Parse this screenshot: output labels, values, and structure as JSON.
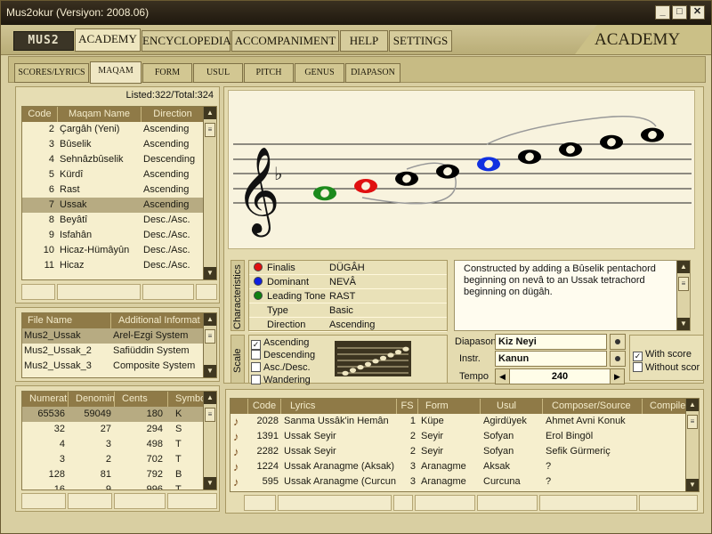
{
  "window": {
    "title": "Mus2okur  (Versiyon: 2008.06)",
    "minimize": "_",
    "maximize": "□",
    "close": "✕"
  },
  "logo": "MUS2",
  "main_tabs": [
    "ACADEMY",
    "ENCYCLOPEDIA",
    "ACCOMPANIMENT",
    "HELP",
    "SETTINGS"
  ],
  "section_title": "ACADEMY",
  "sub_tabs": [
    "SCORES/LYRICS",
    "MAQAM",
    "FORM",
    "USUL",
    "PITCH",
    "GENUS",
    "DIAPASON"
  ],
  "maqam_list": {
    "listed": "Listed:322/Total:324",
    "columns": [
      "Code",
      "Maqam Name",
      "Direction"
    ],
    "rows": [
      [
        "2",
        "Çargâh (Yeni)",
        "Ascending"
      ],
      [
        "3",
        "Bûselik",
        "Ascending"
      ],
      [
        "4",
        "Sehnâzbûselik",
        "Descending"
      ],
      [
        "5",
        "Kürdî",
        "Ascending"
      ],
      [
        "6",
        "Rast",
        "Ascending"
      ],
      [
        "7",
        "Ussak",
        "Ascending"
      ],
      [
        "8",
        "Beyâtî",
        "Desc./Asc."
      ],
      [
        "9",
        "Isfahân",
        "Desc./Asc."
      ],
      [
        "10",
        "Hicaz-Hümâyûn",
        "Desc./Asc."
      ],
      [
        "11",
        "Hicaz",
        "Desc./Asc."
      ]
    ],
    "selected_index": 5
  },
  "files": {
    "columns": [
      "File Name",
      "Additional Informat"
    ],
    "rows": [
      [
        "Mus2_Ussak",
        "Arel-Ezgi System"
      ],
      [
        "Mus2_Ussak_2",
        "Safiüddin System"
      ],
      [
        "Mus2_Ussak_3",
        "Composite System"
      ]
    ],
    "selected_index": 0
  },
  "ratios": {
    "columns": [
      "Numerat",
      "Denomin",
      "Cents",
      "Symbo"
    ],
    "rows": [
      [
        "65536",
        "59049",
        "180",
        "K"
      ],
      [
        "32",
        "27",
        "294",
        "S"
      ],
      [
        "4",
        "3",
        "498",
        "T"
      ],
      [
        "3",
        "2",
        "702",
        "T"
      ],
      [
        "128",
        "81",
        "792",
        "B"
      ],
      [
        "16",
        "9",
        "996",
        "T"
      ]
    ],
    "selected_index": 0
  },
  "characteristics": {
    "label": "Characteristics",
    "rows": [
      {
        "name": "Finalis",
        "value": "DÜGÂH",
        "color": "#e01010"
      },
      {
        "name": "Dominant",
        "value": "NEVÂ",
        "color": "#1020e0"
      },
      {
        "name": "Leading Tone",
        "value": "RAST",
        "color": "#108010"
      },
      {
        "name": "Type",
        "value": "Basic",
        "color": ""
      },
      {
        "name": "Direction",
        "value": "Ascending",
        "color": ""
      }
    ],
    "description": "Constructed by adding a Bûselik pentachord beginning on nevâ to an Ussak tetrachord beginning on dügâh."
  },
  "scale": {
    "label": "Scale",
    "options": [
      {
        "label": "Ascending",
        "checked": true
      },
      {
        "label": "Descending",
        "checked": false
      },
      {
        "label": "Asc./Desc.",
        "checked": false
      },
      {
        "label": "Wandering",
        "checked": false
      }
    ]
  },
  "playback": {
    "diapason_label": "Diapason",
    "diapason_value": "Kiz Neyi",
    "instr_label": "Instr.",
    "instr_value": "Kanun",
    "tempo_label": "Tempo",
    "tempo_value": "240",
    "with_score": "With score",
    "with_score_checked": true,
    "without_score": "Without scor",
    "without_score_checked": false
  },
  "works": {
    "columns": [
      "Code",
      "Lyrics",
      "FS",
      "Form",
      "Usul",
      "Composer/Source",
      "Compile"
    ],
    "rows": [
      [
        "2028",
        "Sanma Ussâk'in Hemân",
        "1",
        "Küpe",
        "Agirdüyek",
        "Ahmet Avni Konuk",
        ""
      ],
      [
        "1391",
        "Ussak Seyir",
        "2",
        "Seyir",
        "Sofyan",
        "Erol Bingöl",
        ""
      ],
      [
        "2282",
        "Ussak Seyir",
        "2",
        "Seyir",
        "Sofyan",
        "Sefik Gürmeriç",
        ""
      ],
      [
        "1224",
        "Ussak Aranagme (Aksak)",
        "3",
        "Aranagme",
        "Aksak",
        "?",
        ""
      ],
      [
        "595",
        "Ussak Aranagme (Curcuna",
        "3",
        "Aranagme",
        "Curcuna",
        "?",
        ""
      ]
    ]
  },
  "staff": {
    "notes": [
      {
        "degree": -1,
        "color": "#1c8a1c"
      },
      {
        "degree": 0,
        "color": "#e01010"
      },
      {
        "degree": 1,
        "color": "#000000"
      },
      {
        "degree": 2,
        "color": "#000000"
      },
      {
        "degree": 3,
        "color": "#1030e0"
      },
      {
        "degree": 4,
        "color": "#000000"
      },
      {
        "degree": 5,
        "color": "#000000"
      },
      {
        "degree": 6,
        "color": "#000000"
      },
      {
        "degree": 7,
        "color": "#000000"
      }
    ]
  }
}
